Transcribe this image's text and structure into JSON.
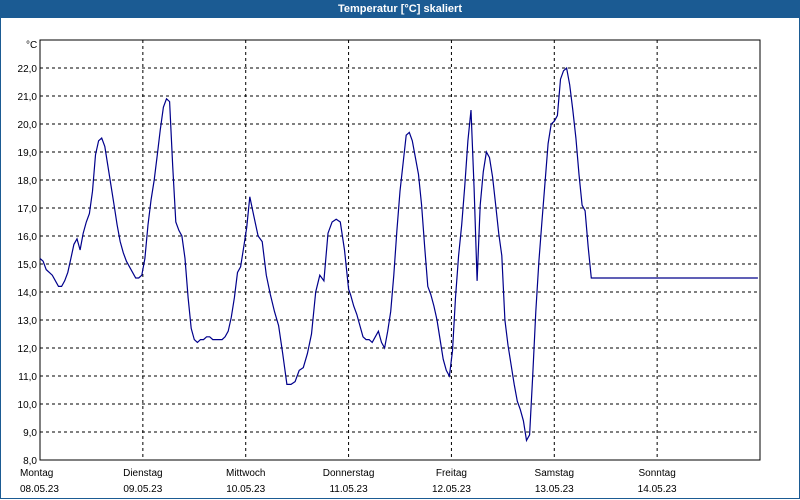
{
  "title": "Temperatur [°C] skaliert",
  "colors": {
    "title_bar": "#1b5b93",
    "line": "#00008b",
    "grid": "#000000"
  },
  "chart_data": {
    "type": "line",
    "title": "Temperatur [°C] skaliert",
    "ylabel": "°C",
    "xlabel": "",
    "ylim": [
      8,
      23
    ],
    "y_ticks": [
      "8,0",
      "9,0",
      "10,0",
      "11,0",
      "12,0",
      "13,0",
      "14,0",
      "15,0",
      "16,0",
      "17,0",
      "18,0",
      "19,0",
      "20,0",
      "21,0",
      "22,0"
    ],
    "x_ticks": [
      {
        "day": "Montag",
        "date": "08.05.23"
      },
      {
        "day": "Dienstag",
        "date": "09.05.23"
      },
      {
        "day": "Mittwoch",
        "date": "10.05.23"
      },
      {
        "day": "Donnerstag",
        "date": "11.05.23"
      },
      {
        "day": "Freitag",
        "date": "12.05.23"
      },
      {
        "day": "Samstag",
        "date": "13.05.23"
      },
      {
        "day": "Sonntag",
        "date": "14.05.23"
      }
    ],
    "grid": true,
    "series": [
      {
        "x": [
          0.0,
          0.03,
          0.06,
          0.09,
          0.12,
          0.15,
          0.18,
          0.21,
          0.24,
          0.27,
          0.3,
          0.33,
          0.36,
          0.39,
          0.42,
          0.45,
          0.48,
          0.51,
          0.54,
          0.57,
          0.6,
          0.63,
          0.66,
          0.69,
          0.72,
          0.75,
          0.78,
          0.81,
          0.84,
          0.87,
          0.9,
          0.93,
          0.96,
          0.99,
          1.02,
          1.05,
          1.08,
          1.11,
          1.14,
          1.17,
          1.2,
          1.23,
          1.26,
          1.29,
          1.32,
          1.35,
          1.38,
          1.41,
          1.44,
          1.47,
          1.5,
          1.53,
          1.56,
          1.59,
          1.62,
          1.65,
          1.68,
          1.71,
          1.74,
          1.77,
          1.8,
          1.83,
          1.86,
          1.89,
          1.92,
          1.95,
          1.98,
          2.01,
          2.04,
          2.08,
          2.12,
          2.16,
          2.2,
          2.24,
          2.28,
          2.32,
          2.36,
          2.4,
          2.44,
          2.48,
          2.52,
          2.56,
          2.6,
          2.64,
          2.68,
          2.72,
          2.76,
          2.8,
          2.84,
          2.88,
          2.92,
          2.96,
          3.0,
          3.02,
          3.05,
          3.08,
          3.11,
          3.14,
          3.17,
          3.2,
          3.23,
          3.26,
          3.29,
          3.32,
          3.35,
          3.38,
          3.41,
          3.44,
          3.47,
          3.5,
          3.53,
          3.56,
          3.59,
          3.62,
          3.65,
          3.68,
          3.71,
          3.74,
          3.77,
          3.8,
          3.83,
          3.86,
          3.89,
          3.92,
          3.95,
          3.98,
          4.01,
          4.04,
          4.07,
          4.1,
          4.13,
          4.16,
          4.19,
          4.22,
          4.25,
          4.28,
          4.31,
          4.34,
          4.37,
          4.4,
          4.43,
          4.46,
          4.49,
          4.52,
          4.55,
          4.58,
          4.61,
          4.64,
          4.67,
          4.7,
          4.73,
          4.76,
          4.79,
          4.82,
          4.85,
          4.88,
          4.91,
          4.94,
          4.97,
          5.0,
          5.03,
          5.06,
          5.09,
          5.12,
          5.15,
          5.18,
          5.21,
          5.24,
          5.27,
          5.3,
          5.33,
          5.36,
          5.39,
          5.42,
          5.45,
          5.48,
          5.51,
          5.54,
          5.57,
          5.6,
          5.63,
          5.66,
          5.69,
          5.72,
          5.75,
          5.78,
          5.81,
          5.84,
          5.87,
          5.9,
          5.93,
          5.96,
          5.99,
          6.02,
          6.05,
          6.08,
          6.11,
          6.14,
          6.17,
          6.2,
          6.23,
          6.26,
          6.29,
          6.32,
          6.35,
          6.38,
          6.41,
          6.44,
          6.47,
          6.5,
          6.53,
          6.56,
          6.59,
          6.62,
          6.65,
          6.68,
          6.71,
          6.74,
          6.77,
          6.8,
          6.83,
          6.86,
          6.89,
          6.92,
          6.95,
          6.98
        ],
        "y": [
          15.2,
          15.1,
          14.8,
          14.7,
          14.6,
          14.4,
          14.2,
          14.2,
          14.4,
          14.7,
          15.2,
          15.7,
          15.9,
          15.5,
          16.1,
          16.5,
          16.8,
          17.6,
          18.9,
          19.4,
          19.5,
          19.2,
          18.5,
          17.8,
          17.1,
          16.4,
          15.8,
          15.4,
          15.1,
          14.9,
          14.7,
          14.5,
          14.5,
          14.6,
          15.2,
          16.4,
          17.3,
          18.0,
          18.9,
          19.8,
          20.6,
          20.9,
          20.8,
          18.5,
          16.5,
          16.2,
          16.0,
          15.2,
          13.8,
          12.7,
          12.3,
          12.2,
          12.3,
          12.3,
          12.4,
          12.4,
          12.3,
          12.3,
          12.3,
          12.3,
          12.4,
          12.6,
          13.1,
          13.8,
          14.7,
          14.9,
          15.6,
          16.3,
          17.4,
          16.7,
          16.0,
          15.8,
          14.6,
          13.9,
          13.3,
          12.8,
          11.8,
          10.7,
          10.7,
          10.8,
          11.2,
          11.3,
          11.8,
          12.5,
          14.0,
          14.6,
          14.4,
          16.1,
          16.5,
          16.6,
          16.5,
          15.5,
          14.1,
          13.9,
          13.5,
          13.2,
          12.8,
          12.4,
          12.3,
          12.3,
          12.2,
          12.4,
          12.6,
          12.2,
          12.0,
          12.6,
          13.3,
          14.6,
          16.2,
          17.6,
          18.6,
          19.6,
          19.7,
          19.4,
          18.8,
          18.2,
          17.1,
          15.6,
          14.2,
          13.9,
          13.5,
          13.0,
          12.3,
          11.6,
          11.2,
          11.0,
          11.9,
          13.8,
          15.3,
          16.4,
          17.8,
          19.4,
          20.5,
          17.7,
          14.4,
          17.1,
          18.3,
          19.0,
          18.8,
          18.1,
          17.1,
          16.1,
          15.3,
          13.0,
          12.1,
          11.4,
          10.7,
          10.1,
          9.8,
          9.4,
          8.7,
          8.9,
          11.0,
          13.3,
          15.1,
          16.5,
          17.9,
          19.3,
          20.0,
          20.1,
          20.3,
          21.6,
          21.9,
          22.0,
          21.4,
          20.5,
          19.5,
          18.2,
          17.1,
          16.9,
          15.6,
          14.5,
          14.5,
          14.5,
          14.5,
          14.5,
          14.5,
          14.5,
          14.5,
          14.5,
          14.5,
          14.5,
          14.5,
          14.5,
          14.5,
          14.5,
          14.5,
          14.5,
          14.5,
          14.5,
          14.5,
          14.5,
          14.5,
          14.5,
          14.5,
          14.5,
          14.5,
          14.5,
          14.5,
          14.5,
          14.5,
          14.5,
          14.5,
          14.5,
          14.5,
          14.5,
          14.5,
          14.5,
          14.5,
          14.5,
          14.5,
          14.5,
          14.5,
          14.5,
          14.5,
          14.5,
          14.5,
          14.5,
          14.5,
          14.5,
          14.5,
          14.5,
          14.5,
          14.5,
          14.5,
          14.5
        ]
      }
    ]
  }
}
